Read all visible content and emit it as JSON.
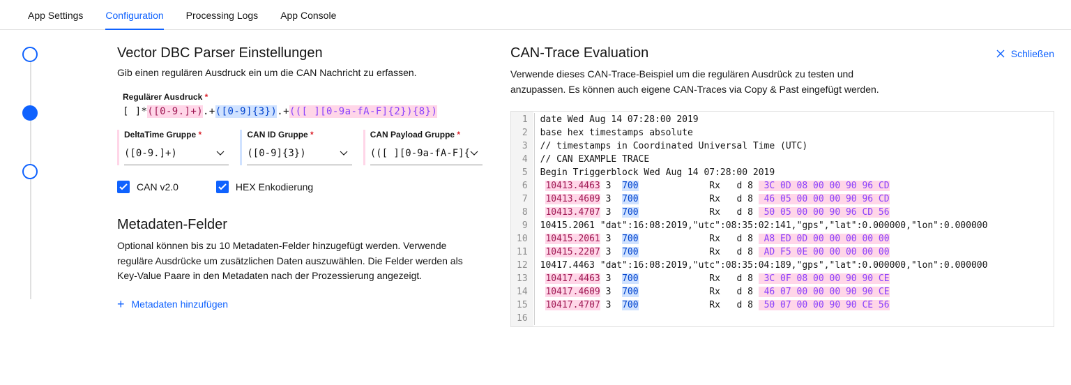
{
  "tabs": {
    "items": [
      "App Settings",
      "Configuration",
      "Processing Logs",
      "App Console"
    ],
    "active_index": 1
  },
  "settings": {
    "title": "Vector DBC Parser Einstellungen",
    "intro": "Gib einen regulären Ausdruck ein um die CAN Nachricht zu erfassen.",
    "regex_label": "Regulärer Ausdruck",
    "regex_parts": {
      "pre": "[ ]*",
      "g1": "([0-9.]+)",
      "sep1": ".+",
      "g2": "([0-9]{3})",
      "sep2": ".+",
      "g3": "(([ ][0-9a-fA-F]{2}){8})"
    },
    "groups": [
      {
        "label": "DeltaTime Gruppe",
        "value": "([0-9.]+)"
      },
      {
        "label": "CAN ID Gruppe",
        "value": "([0-9]{3})"
      },
      {
        "label": "CAN Payload Gruppe",
        "value": "(([ ][0-9a-fA-F]{"
      }
    ],
    "checkboxes": {
      "can_v2": {
        "label": "CAN v2.0",
        "checked": true
      },
      "hex_enc": {
        "label": "HEX Enkodierung",
        "checked": true
      }
    }
  },
  "metadata": {
    "title": "Metadaten-Felder",
    "desc": "Optional können bis zu 10 Metadaten-Felder hinzugefügt werden. Verwende reguläre Ausdrücke um zusätzlichen Daten auszuwählen. Die Felder werden als Key-Value Paare in den Metadaten nach der Prozessierung angezeigt.",
    "add_label": "Metadaten hinzufügen"
  },
  "trace": {
    "title": "CAN-Trace Evaluation",
    "close": "Schließen",
    "desc": "Verwende dieses CAN-Trace-Beispiel um die regulären Ausdrück zu testen und anzupassen. Es können auch eigene CAN-Traces via Copy & Past eingefügt werden.",
    "lines": [
      {
        "n": 1,
        "raw": "date Wed Aug 14 07:28:00 2019"
      },
      {
        "n": 2,
        "raw": "base hex timestamps absolute"
      },
      {
        "n": 3,
        "raw": "// timestamps in Coordinated Universal Time (UTC)"
      },
      {
        "n": 4,
        "raw": "// CAN EXAMPLE TRACE"
      },
      {
        "n": 5,
        "raw": "Begin Triggerblock Wed Aug 14 07:28:00 2019"
      },
      {
        "n": 6,
        "time": "10413.4463",
        "bus": "3",
        "id": "700",
        "dir": "Rx",
        "dlc": "d 8",
        "payload": "3C 0D 08 00 00 90 96 CD"
      },
      {
        "n": 7,
        "time": "10413.4609",
        "bus": "3",
        "id": "700",
        "dir": "Rx",
        "dlc": "d 8",
        "payload": "46 05 00 00 00 90 96 CD"
      },
      {
        "n": 8,
        "time": "10413.4707",
        "bus": "3",
        "id": "700",
        "dir": "Rx",
        "dlc": "d 8",
        "payload": "50 05 00 00 90 96 CD 56"
      },
      {
        "n": 9,
        "raw": "10415.2061 \"dat\":16:08:2019,\"utc\":08:35:02:141,\"gps\",\"lat\":0.000000,\"lon\":0.000000"
      },
      {
        "n": 10,
        "time": "10415.2061",
        "bus": "3",
        "id": "700",
        "dir": "Rx",
        "dlc": "d 8",
        "payload": "A8 ED 0D 00 00 00 00 00"
      },
      {
        "n": 11,
        "time": "10415.2207",
        "bus": "3",
        "id": "700",
        "dir": "Rx",
        "dlc": "d 8",
        "payload": "AD F5 0E 00 00 00 00 00"
      },
      {
        "n": 12,
        "raw": "10417.4463 \"dat\":16:08:2019,\"utc\":08:35:04:189,\"gps\",\"lat\":0.000000,\"lon\":0.000000"
      },
      {
        "n": 13,
        "time": "10417.4463",
        "bus": "3",
        "id": "700",
        "dir": "Rx",
        "dlc": "d 8",
        "payload": "3C 0F 08 00 00 90 90 CE"
      },
      {
        "n": 14,
        "time": "10417.4609",
        "bus": "3",
        "id": "700",
        "dir": "Rx",
        "dlc": "d 8",
        "payload": "46 07 00 00 00 90 90 CE"
      },
      {
        "n": 15,
        "time": "10417.4707",
        "bus": "3",
        "id": "700",
        "dir": "Rx",
        "dlc": "d 8",
        "payload": "50 07 00 00 90 90 CE 56"
      },
      {
        "n": 16,
        "raw": ""
      }
    ]
  }
}
